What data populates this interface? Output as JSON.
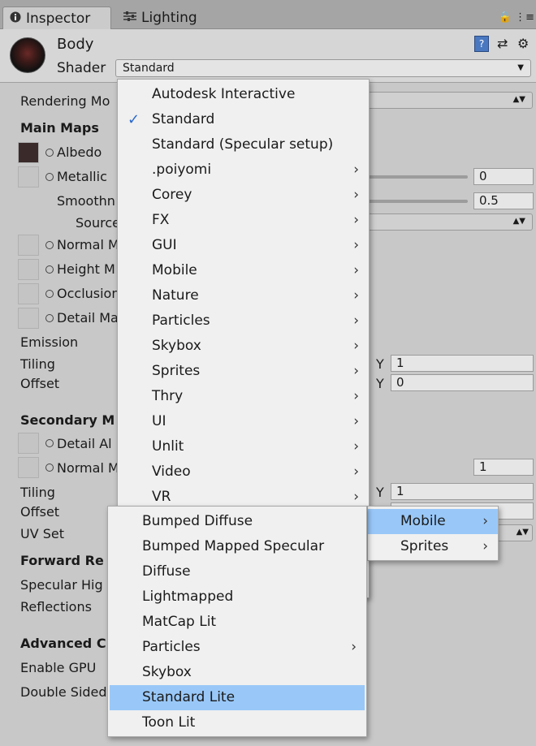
{
  "tabs": [
    {
      "label": "Inspector",
      "icon": "info-icon"
    },
    {
      "label": "Lighting",
      "icon": "sliders-icon"
    }
  ],
  "header": {
    "material_name": "Body",
    "shader_label": "Shader",
    "shader_value": "Standard"
  },
  "inspector": {
    "rendering_mode": "Rendering Mo",
    "main_maps": "Main Maps",
    "albedo": "Albedo",
    "metallic": "Metallic",
    "metallic_value": "0",
    "smoothness": "Smoothn",
    "smoothness_value": "0.5",
    "source": "Source",
    "normal_map": "Normal M",
    "height_map": "Height M",
    "occlusion": "Occlusion",
    "detail_mask": "Detail Ma",
    "emission": "Emission",
    "tiling": "Tiling",
    "offset": "Offset",
    "y_label": "Y",
    "tiling_y": "1",
    "offset_y": "0",
    "secondary_maps": "Secondary M",
    "detail_albedo": "Detail Al",
    "normal_map2": "Normal M",
    "normal_scale": "1",
    "tiling2": "Tiling",
    "offset2": "Offset",
    "tiling2_y": "1",
    "uv_set": "UV Set",
    "forward_rendering": "Forward Re",
    "specular_highlights": "Specular Hig",
    "reflections": "Reflections",
    "advanced": "Advanced C",
    "enable_gpu": "Enable GPU",
    "double_sided": "Double Sided"
  },
  "shader_menu": {
    "items": [
      {
        "label": "Autodesk Interactive",
        "submenu": false
      },
      {
        "label": "Standard",
        "submenu": false,
        "checked": true
      },
      {
        "label": "Standard (Specular setup)",
        "submenu": false
      },
      {
        "label": ".poiyomi",
        "submenu": true
      },
      {
        "label": "Corey",
        "submenu": true
      },
      {
        "label": "FX",
        "submenu": true
      },
      {
        "label": "GUI",
        "submenu": true
      },
      {
        "label": "Mobile",
        "submenu": true
      },
      {
        "label": "Nature",
        "submenu": true
      },
      {
        "label": "Particles",
        "submenu": true
      },
      {
        "label": "Skybox",
        "submenu": true
      },
      {
        "label": "Sprites",
        "submenu": true
      },
      {
        "label": "Thry",
        "submenu": true
      },
      {
        "label": "UI",
        "submenu": true
      },
      {
        "label": "Unlit",
        "submenu": true
      },
      {
        "label": "Video",
        "submenu": true
      },
      {
        "label": "VR",
        "submenu": true
      }
    ]
  },
  "poiyomi_submenu": {
    "items": [
      {
        "label": "Mobile",
        "submenu": true,
        "highlighted": true
      },
      {
        "label": "Sprites",
        "submenu": true
      }
    ]
  },
  "mobile_submenu": {
    "items": [
      {
        "label": "Bumped Diffuse",
        "submenu": false
      },
      {
        "label": "Bumped Mapped Specular",
        "submenu": false
      },
      {
        "label": "Diffuse",
        "submenu": false
      },
      {
        "label": "Lightmapped",
        "submenu": false
      },
      {
        "label": "MatCap Lit",
        "submenu": false
      },
      {
        "label": "Particles",
        "submenu": true
      },
      {
        "label": "Skybox",
        "submenu": false
      },
      {
        "label": "Standard Lite",
        "submenu": false,
        "highlighted": true
      },
      {
        "label": "Toon Lit",
        "submenu": false
      }
    ]
  },
  "colors": {
    "highlight": "#99c8f8",
    "check": "#2a6acb",
    "panel": "#c8c8c8",
    "menu_bg": "#f0f0f0"
  }
}
